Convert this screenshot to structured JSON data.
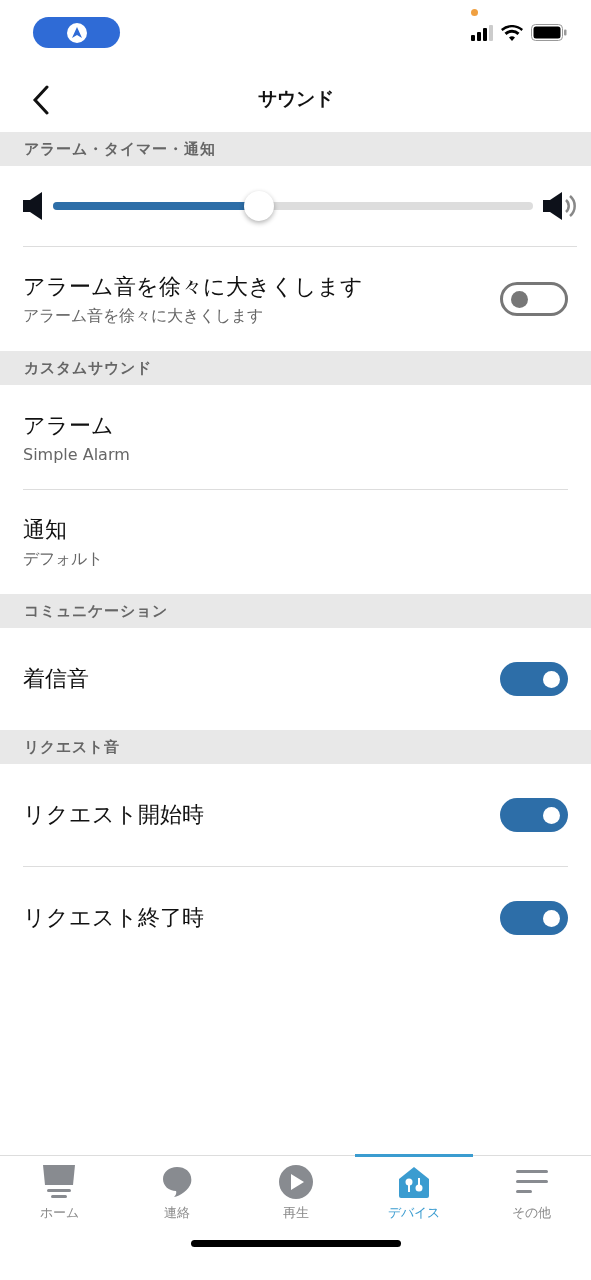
{
  "header": {
    "title": "サウンド"
  },
  "sections": [
    {
      "title": "アラーム・タイマー・通知",
      "items": [
        {
          "kind": "slider",
          "level": 0.43
        },
        {
          "kind": "toggle",
          "label": "アラーム音を徐々に大きくします",
          "sublabel": "アラーム音を徐々に大きくします",
          "on": false
        }
      ]
    },
    {
      "title": "カスタムサウンド",
      "items": [
        {
          "kind": "link",
          "label": "アラーム",
          "sublabel": "Simple Alarm"
        },
        {
          "kind": "link",
          "label": "通知",
          "sublabel": "デフォルト"
        }
      ]
    },
    {
      "title": "コミュニケーション",
      "items": [
        {
          "kind": "toggle",
          "label": "着信音",
          "on": true
        }
      ]
    },
    {
      "title": "リクエスト音",
      "items": [
        {
          "kind": "toggle",
          "label": "リクエスト開始時",
          "on": true
        },
        {
          "kind": "toggle",
          "label": "リクエスト終了時",
          "on": true
        }
      ]
    }
  ],
  "tab_bar": [
    {
      "kind": "home",
      "label": "ホーム",
      "selected": false
    },
    {
      "kind": "chat",
      "label": "連絡",
      "selected": false
    },
    {
      "kind": "play",
      "label": "再生",
      "selected": false
    },
    {
      "kind": "devices",
      "label": "デバイス",
      "selected": true
    },
    {
      "kind": "more",
      "label": "その他",
      "selected": false
    }
  ]
}
